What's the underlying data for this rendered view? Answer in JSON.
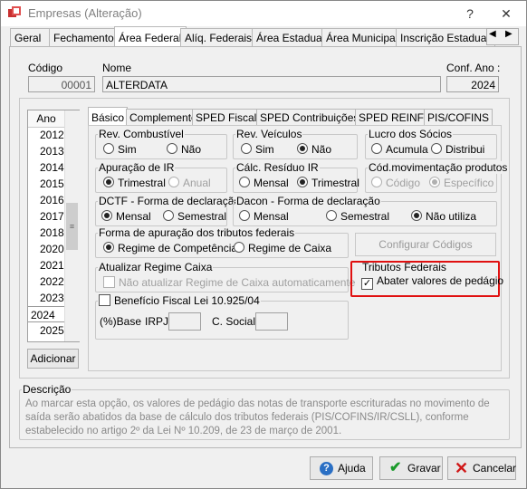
{
  "window": {
    "title": "Empresas (Alteração)"
  },
  "tabs": [
    "Geral",
    "Fechamento",
    "Área Federal",
    "Alíq. Federais",
    "Área Estadual",
    "Área Municipal",
    "Inscrição Estadual S"
  ],
  "header": {
    "codigo_label": "Código",
    "codigo_value": "00001",
    "nome_label": "Nome",
    "nome_value": "ALTERDATA",
    "conf_ano_label": "Conf. Ano :",
    "conf_ano_value": "2024"
  },
  "years": {
    "header": "Ano",
    "items": [
      "2012",
      "2013",
      "2014",
      "2015",
      "2016",
      "2017",
      "2018",
      "2020",
      "2021",
      "2022",
      "2023",
      "2024",
      "2025"
    ],
    "selected": "2024",
    "add_button": "Adicionar"
  },
  "subtabs": [
    "Básico",
    "Complemento",
    "SPED Fiscal",
    "SPED Contribuições",
    "SPED REINF",
    "PIS/COFINS"
  ],
  "groups": {
    "rev_combustivel": {
      "label": "Rev. Combustível",
      "options": [
        "Sim",
        "Não"
      ]
    },
    "rev_veiculos": {
      "label": "Rev. Veículos",
      "options": [
        "Sim",
        "Não"
      ],
      "selected": "Não"
    },
    "lucro_socios": {
      "label": "Lucro dos Sócios",
      "options": [
        "Acumula",
        "Distribui"
      ]
    },
    "apuracao_ir": {
      "label": "Apuração de IR",
      "options": [
        "Trimestral",
        "Anual"
      ],
      "selected": "Trimestral"
    },
    "calc_residuo_ir": {
      "label": "Cálc. Resíduo IR",
      "options": [
        "Mensal",
        "Trimestral"
      ],
      "selected": "Trimestral"
    },
    "cod_movimentacao": {
      "label": "Cód.movimentação produtos",
      "options": [
        "Código",
        "Específico"
      ],
      "selected": "Específico"
    },
    "dctf": {
      "label": "DCTF - Forma de declaração",
      "options": [
        "Mensal",
        "Semestral"
      ],
      "selected": "Mensal"
    },
    "dacon": {
      "label": "Dacon - Forma de declaração",
      "options": [
        "Mensal",
        "Semestral",
        "Não utiliza"
      ],
      "selected": "Não utiliza"
    },
    "forma_apuracao": {
      "label": "Forma de apuração dos tributos federais",
      "options": [
        "Regime de Competência",
        "Regime de Caixa"
      ],
      "selected": "Regime de Competência"
    },
    "atualizar_regime": {
      "label": "Atualizar Regime Caixa",
      "checkbox": "Não atualizar Regime de Caixa automaticamente"
    },
    "beneficio": {
      "label": "Benefício Fiscal Lei 10.925/04",
      "base_label": "(%)Base",
      "irpj_label": "IRPJ",
      "csocial_label": "C. Social"
    },
    "tributos": {
      "label": "Tributos Federais",
      "checkbox": "Abater valores de pedágio",
      "checked": "✓"
    }
  },
  "configurar_button": "Configurar Códigos",
  "descricao": {
    "label": "Descrição",
    "text": "Ao marcar esta opção, os valores de pedágio das notas de transporte escrituradas no movimento de saída serão abatidos da base de cálculo dos tributos federais (PIS/COFINS/IR/CSLL), conforme estabelecido no artigo 2º da Lei Nº 10.209, de 23 de março de 2001."
  },
  "footer": {
    "ajuda": "Ajuda",
    "gravar": "Gravar",
    "cancelar": "Cancelar"
  },
  "colors": {
    "highlight": "#e01010",
    "accent_blue": "#0f5fb5",
    "selected_row": "#ffffff"
  }
}
